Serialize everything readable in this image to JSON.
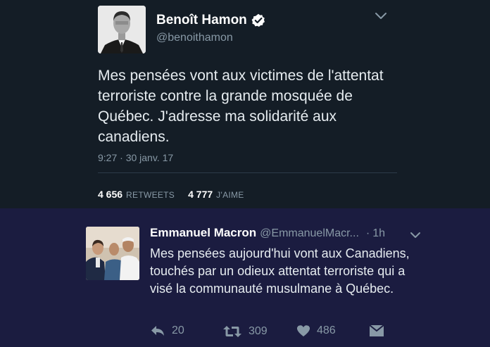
{
  "tweet_main": {
    "author_name": "Benoît Hamon",
    "handle": "@benoithamon",
    "text": "Mes pensées vont aux victimes de l'attentat terroriste contre la grande mosquée de Québec. J'adresse ma solidarité aux canadiens.",
    "timestamp": "9:27 · 30 janv. 17",
    "retweets_count": "4 656",
    "retweets_label": "RETWEETS",
    "likes_count": "4 777",
    "likes_label": "J'AIME"
  },
  "tweet_reply": {
    "author_name": "Emmanuel Macron",
    "handle": "@EmmanuelMacr...",
    "separator": "·",
    "time": "1h",
    "text": "Mes pensées aujourd'hui vont aux Canadiens, touchés par un odieux attentat terroriste qui a visé la communauté musulmane à Québec.",
    "replies_count": "20",
    "retweets_count": "309",
    "likes_count": "486"
  },
  "icons": {
    "verified": "verified-badge-icon",
    "chevron": "chevron-down-icon",
    "reply": "reply-icon",
    "retweet": "retweet-icon",
    "like": "heart-icon",
    "dm": "direct-message-icon"
  },
  "colors": {
    "background_top": "#141d26",
    "background_bottom": "#1b1c40",
    "text_secondary": "#8899a6"
  }
}
